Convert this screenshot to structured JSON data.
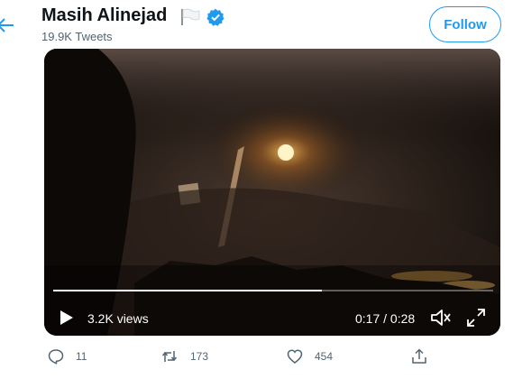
{
  "profile": {
    "name": "Masih Alinejad",
    "tweets": "19.9K Tweets",
    "follow_label": "Follow"
  },
  "video": {
    "views": "3.2K views",
    "time": "0:17 / 0:28",
    "progress": 0.61
  },
  "actions": {
    "replies": "11",
    "retweets": "173",
    "likes": "454"
  },
  "colors": {
    "accent": "#1d9bf0",
    "muted": "#536471"
  },
  "icons": [
    "back-arrow-icon",
    "flag-icon",
    "verified-badge-icon",
    "play-icon",
    "volume-icon",
    "fullscreen-icon",
    "reply-icon",
    "retweet-icon",
    "like-icon",
    "share-icon"
  ]
}
